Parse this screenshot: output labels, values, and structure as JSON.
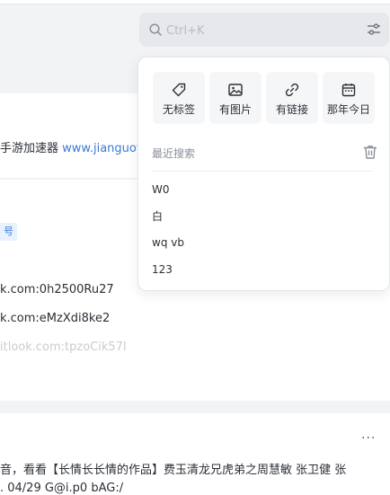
{
  "search": {
    "placeholder": "Ctrl+K"
  },
  "dropdown": {
    "quick_filters": [
      {
        "label": "无标签",
        "icon": "tag-icon"
      },
      {
        "label": "有图片",
        "icon": "image-icon"
      },
      {
        "label": "有链接",
        "icon": "link-icon"
      },
      {
        "label": "那年今日",
        "icon": "calendar-icon"
      }
    ],
    "recent_title": "最近搜索",
    "recent_items": [
      "W0",
      "白",
      "wq vb",
      "123"
    ]
  },
  "background": {
    "card1_text": "手游加速器 ",
    "card1_link": "www.jianguoyu",
    "tag": "号",
    "lines": [
      "k.com:0h2500Ru27",
      "k.com:eMzXdi8ke2",
      "itlook.com:tpzoCik57l"
    ],
    "card3_line1": "音，看看【长情长长情的作品】费玉清龙兄虎弟之周慧敏 张卫健 张",
    "card3_line2": ". 04/29 G@i.p0 bAG:/",
    "more": "···"
  },
  "colors": {
    "link": "#3d7ad6",
    "tag_bg": "#e8f1fe"
  }
}
